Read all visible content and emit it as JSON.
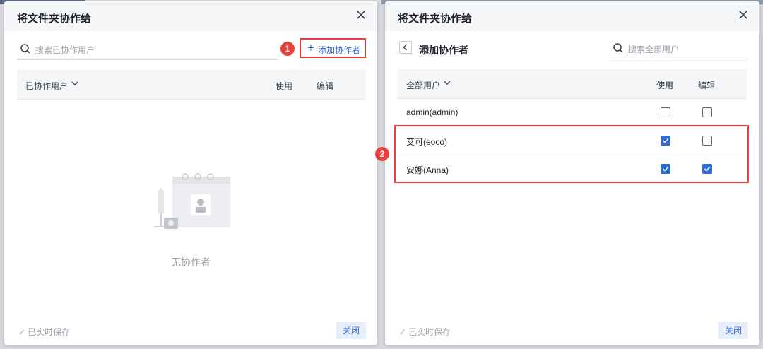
{
  "left_dialog": {
    "title": "将文件夹协作给",
    "search_placeholder": "搜索已协作用户",
    "add_button_label": "添加协作者",
    "marker": "1",
    "columns": [
      "已协作用户",
      "使用",
      "编辑"
    ],
    "empty_text": "无协作者",
    "saved_text": "已实时保存",
    "close_label": "关闭"
  },
  "right_dialog": {
    "title": "将文件夹协作给",
    "subtitle": "添加协作者",
    "search_placeholder": "搜索全部用户",
    "marker": "2",
    "columns": [
      "全部用户",
      "使用",
      "编辑"
    ],
    "users": [
      {
        "name": "admin(admin)",
        "use": false,
        "edit": false
      },
      {
        "name": "艾可(eoco)",
        "use": true,
        "edit": false
      },
      {
        "name": "安娜(Anna)",
        "use": true,
        "edit": true
      }
    ],
    "saved_text": "已实时保存",
    "close_label": "关闭"
  },
  "colors": {
    "accent": "#2f6bd8",
    "highlight": "#e8413c"
  }
}
